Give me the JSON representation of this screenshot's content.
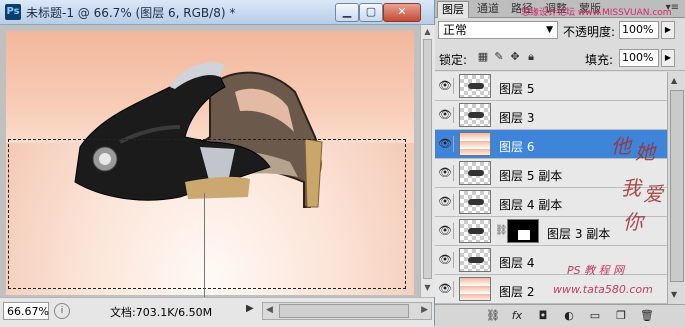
{
  "document": {
    "title": "未标题-1 @ 66.7% (图层 6, RGB/8) *",
    "app_icon": "Ps",
    "zoom": "66.67%",
    "doc_info": "文档:703.1K/6.50M",
    "min_icon": "minimize-icon",
    "max_icon": "maximize-icon",
    "close_icon": "close-icon"
  },
  "panel": {
    "tabs": [
      {
        "label": "图层",
        "active": true
      },
      {
        "label": "通道",
        "active": false
      },
      {
        "label": "路径",
        "active": false
      },
      {
        "label": "调整",
        "active": false
      },
      {
        "label": "蒙版",
        "active": false
      }
    ],
    "watermark_top": "思缘设计论坛 www.MISSVUAN.com",
    "blend_mode": "正常",
    "opacity_label": "不透明度:",
    "opacity_value": "100%",
    "lock_label": "锁定:",
    "fill_label": "填充:",
    "fill_value": "100%"
  },
  "layers": [
    {
      "name": "图层 5",
      "selected": false,
      "thumb": "shoe-small",
      "mask": false
    },
    {
      "name": "图层 3",
      "selected": false,
      "thumb": "shoe-small",
      "mask": false
    },
    {
      "name": "图层 6",
      "selected": true,
      "thumb": "gradient",
      "mask": false
    },
    {
      "name": "图层 5 副本",
      "selected": false,
      "thumb": "shoe-small",
      "mask": false
    },
    {
      "name": "图层 4 副本",
      "selected": false,
      "thumb": "shoe-small",
      "mask": false
    },
    {
      "name": "图层 3 副本",
      "selected": false,
      "thumb": "shoe-small",
      "mask": true
    },
    {
      "name": "图层 4",
      "selected": false,
      "thumb": "shoe-small",
      "mask": false
    },
    {
      "name": "图层 2",
      "selected": false,
      "thumb": "gradient",
      "mask": false
    }
  ],
  "watermark": {
    "chars": [
      "他",
      "她",
      "我",
      "爱",
      "你"
    ],
    "ps_text": "PS 教 程 网",
    "url": "www.tata580.com"
  },
  "bottom_icons": [
    "link-layers-icon",
    "fx-icon",
    "add-mask-icon",
    "adjustment-layer-icon",
    "group-folder-icon",
    "new-layer-icon",
    "trash-icon"
  ]
}
